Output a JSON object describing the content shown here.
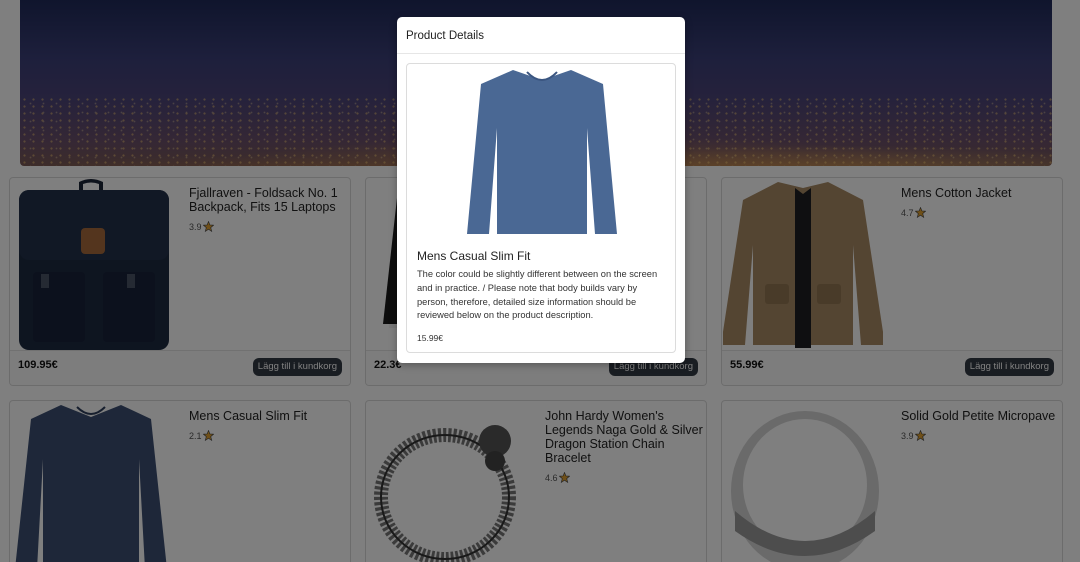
{
  "colors": {
    "overlay": "rgba(0,0,0,0.5)",
    "button_bg": "#333a45",
    "star": "#e0a030"
  },
  "products": [
    {
      "title": "Fjallraven - Foldsack No. 1 Backpack, Fits 15 Laptops",
      "rating": "3.9",
      "price": "109.95€",
      "button": "Lägg till i kundkorg",
      "image": "backpack-image"
    },
    {
      "title": "",
      "rating": "",
      "price": "22.3€",
      "button": "Lägg till i kundkorg",
      "image": "raglan-shirt-image"
    },
    {
      "title": "Mens Cotton Jacket",
      "rating": "4.7",
      "price": "55.99€",
      "button": "Lägg till i kundkorg",
      "image": "jacket-image"
    },
    {
      "title": "Mens Casual Slim Fit",
      "rating": "2.1",
      "image": "slim-fit-shirt-image"
    },
    {
      "title": "John Hardy Women's Legends Naga Gold & Silver Dragon Station Chain Bracelet",
      "rating": "4.6",
      "image": "bracelet-image"
    },
    {
      "title": "Solid Gold Petite Micropave",
      "rating": "3.9",
      "image": "ring-image"
    }
  ],
  "modal": {
    "header": "Product Details",
    "title": "Mens Casual Slim Fit",
    "description": "The color could be slightly different between on the screen and in practice. / Please note that body builds vary by person, therefore, detailed size information should be reviewed below on the product description.",
    "price": "15.99€"
  }
}
